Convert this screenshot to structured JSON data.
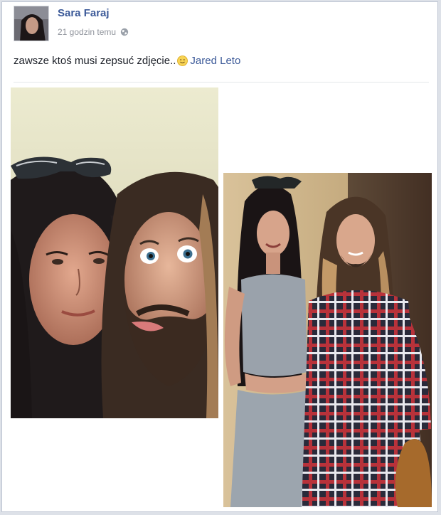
{
  "post": {
    "author": "Sara Faraj",
    "timestamp": "21 godzin temu",
    "privacy_icon": "globe-icon",
    "text": "zawsze ktoś musi zepsuć zdjęcie..",
    "emoji": "smile-emoji",
    "tagged_person": "Jared Leto"
  },
  "photos": [
    {
      "subject": "close-up selfie of two people, man with tongue out"
    },
    {
      "subject": "two people standing, man in plaid shirt"
    }
  ],
  "colors": {
    "link": "#3b5998",
    "text": "#1d2129",
    "meta": "#90949c",
    "background": "#dde1e8"
  }
}
